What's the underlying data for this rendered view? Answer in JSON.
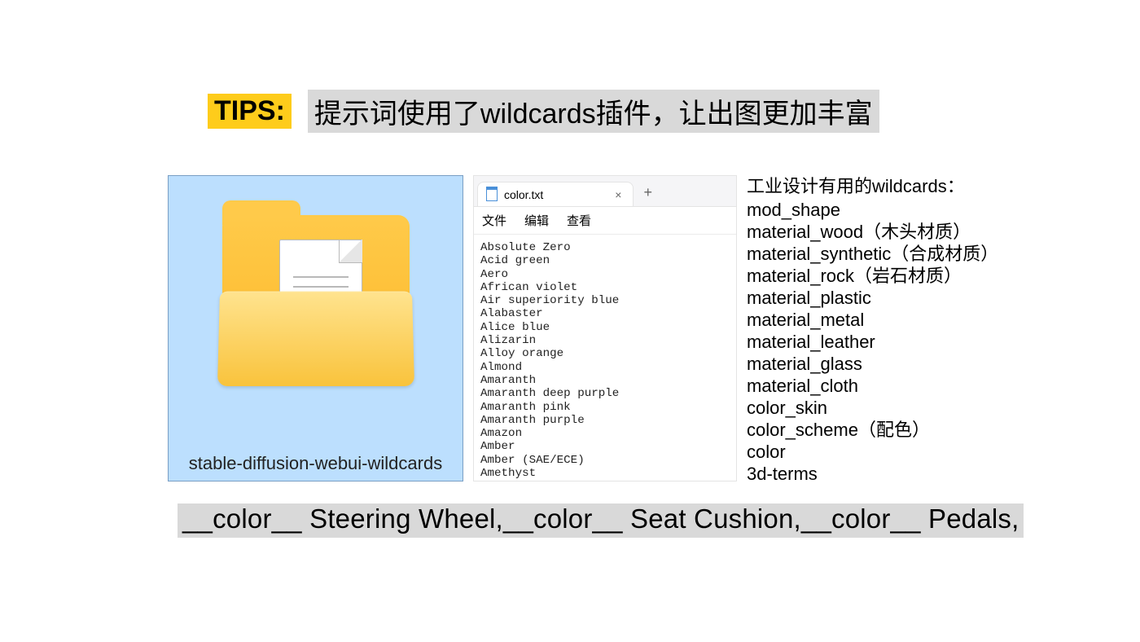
{
  "header": {
    "tips_label": "TIPS:",
    "tips_desc": "提示词使用了wildcards插件，让出图更加丰富"
  },
  "folder": {
    "caption": "stable-diffusion-webui-wildcards"
  },
  "editor": {
    "tab_title": "color.txt",
    "menus": {
      "file": "文件",
      "edit": "编辑",
      "view": "查看"
    },
    "lines": [
      "Absolute Zero",
      "Acid green",
      "Aero",
      "African violet",
      "Air superiority blue",
      "Alabaster",
      "Alice blue",
      "Alizarin",
      "Alloy orange",
      "Almond",
      "Amaranth",
      "Amaranth deep purple",
      "Amaranth pink",
      "Amaranth purple",
      "Amazon",
      "Amber",
      "Amber (SAE/ECE)",
      "Amethyst"
    ]
  },
  "wildcards": {
    "heading": "工业设计有用的wildcards：",
    "items": [
      "mod_shape",
      "material_wood（木头材质）",
      "material_synthetic（合成材质）",
      "material_rock（岩石材质）",
      "material_plastic",
      "material_metal",
      "material_leather",
      "material_glass",
      "material_cloth",
      "color_skin",
      "color_scheme（配色）",
      "color",
      "3d-terms"
    ]
  },
  "prompt": {
    "text": "__color__ Steering Wheel,__color__ Seat Cushion,__color__ Pedals,"
  }
}
